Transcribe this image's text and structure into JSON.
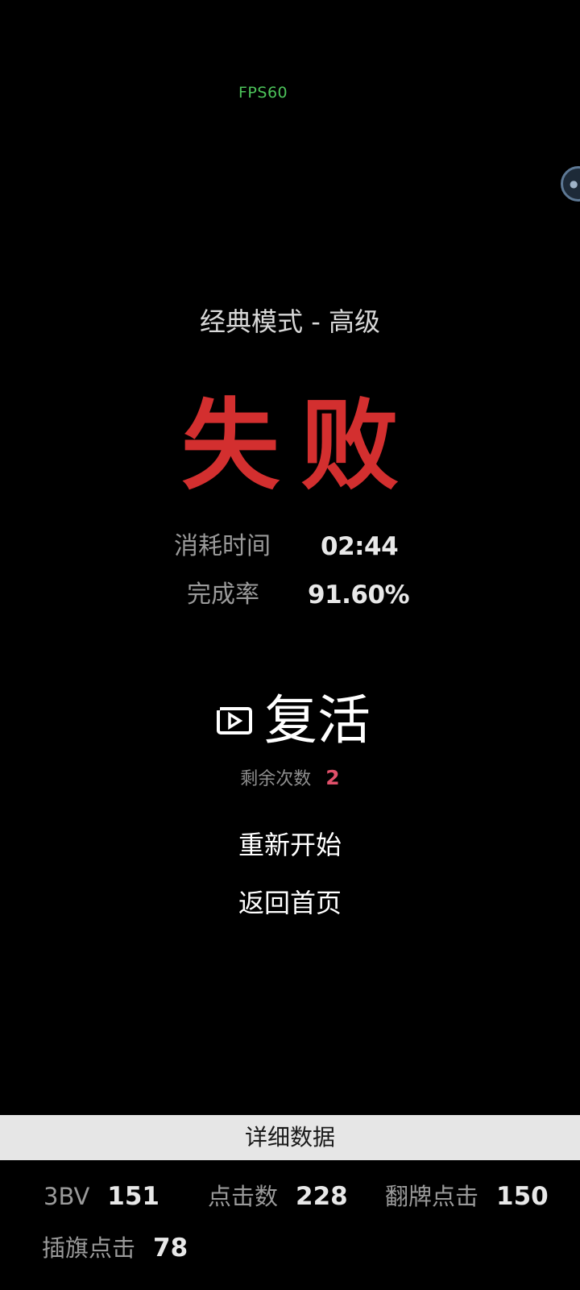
{
  "overlay": {
    "fps": "FPS60"
  },
  "game": {
    "mode_title": "经典模式 - 高级",
    "result": "失败",
    "stats": [
      {
        "label": "消耗时间",
        "value": "02:44"
      },
      {
        "label": "完成率",
        "value": "91.60%"
      }
    ],
    "revive": {
      "label": "复活",
      "icon": "video-ad-icon",
      "remaining_label": "剩余次数",
      "remaining_count": "2"
    },
    "restart_label": "重新开始",
    "home_label": "返回首页"
  },
  "details": {
    "header": "详细数据",
    "items": [
      {
        "label": "3BV",
        "value": "151"
      },
      {
        "label": "点击数",
        "value": "228"
      },
      {
        "label": "翻牌点击",
        "value": "150"
      },
      {
        "label": "插旗点击",
        "value": "78"
      }
    ]
  },
  "colors": {
    "background": "#000000",
    "fail_red": "#d32f2f",
    "fps_green": "#4cc35a",
    "count_pink": "#e0506a",
    "detail_bar": "#e6e6e6"
  }
}
